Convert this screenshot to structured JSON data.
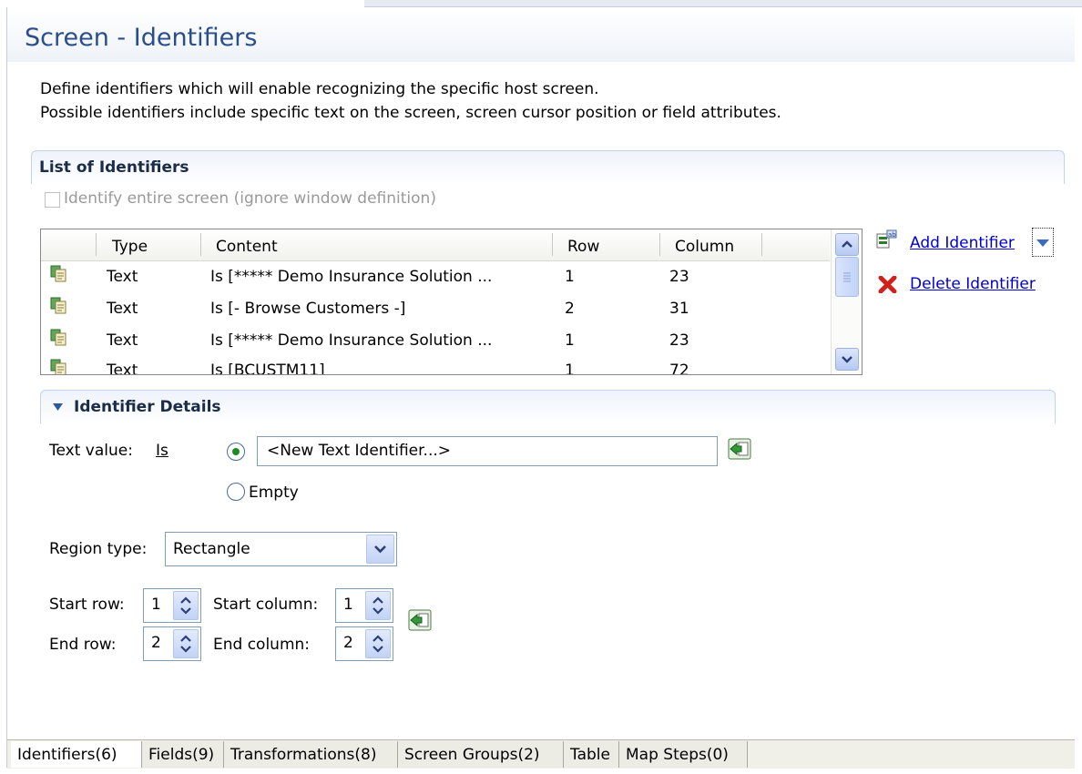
{
  "page": {
    "title": "Screen - Identifiers",
    "description_line1": "Define identifiers which will enable recognizing the specific host screen.",
    "description_line2": "Possible identifiers include specific text on the screen, screen cursor position or field attributes."
  },
  "list_section": {
    "title": "List of Identifiers",
    "identify_entire_label": "Identify entire screen (ignore window definition)",
    "identify_entire_checked": false,
    "columns": [
      "Type",
      "Content",
      "Row",
      "Column"
    ],
    "rows": [
      {
        "type": "Text",
        "content": "Is [***** Demo Insurance Solution ...",
        "row": "1",
        "column": "23"
      },
      {
        "type": "Text",
        "content": "Is [- Browse Customers -]",
        "row": "2",
        "column": "31"
      },
      {
        "type": "Text",
        "content": "Is [***** Demo Insurance Solution ...",
        "row": "1",
        "column": "23"
      },
      {
        "type": "Text",
        "content": "Is [BCUSTM11]",
        "row": "1",
        "column": "72"
      }
    ],
    "add_label": "Add Identifier",
    "delete_label": "Delete Identifier"
  },
  "details_section": {
    "title": "Identifier Details",
    "text_value_label": "Text value:",
    "is_label": "Is",
    "text_value": "<New Text Identifier...>",
    "empty_label": "Empty",
    "selected_option": "text",
    "region_type_label": "Region type:",
    "region_type_value": "Rectangle",
    "start_row_label": "Start row:",
    "start_row": "1",
    "start_column_label": "Start column:",
    "start_column": "1",
    "end_row_label": "End row:",
    "end_row": "2",
    "end_column_label": "End column:",
    "end_column": "2"
  },
  "tabs": [
    {
      "label": "Identifiers(6)",
      "active": true
    },
    {
      "label": "Fields(9)",
      "active": false
    },
    {
      "label": "Transformations(8)",
      "active": false
    },
    {
      "label": "Screen Groups(2)",
      "active": false
    },
    {
      "label": "Table",
      "active": false
    },
    {
      "label": "Map Steps(0)",
      "active": false
    }
  ],
  "colors": {
    "title": "#2a4d8c",
    "link": "#0000d0",
    "section_border": "#c3d3ea",
    "radio_selected": "#1d8a24",
    "delete_icon": "#d2201c"
  }
}
